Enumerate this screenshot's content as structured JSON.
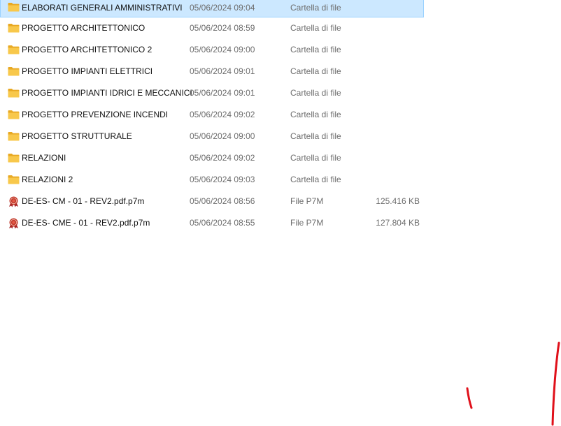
{
  "files": [
    {
      "name": "ELABORATI GENERALI AMMINISTRATIVI",
      "date": "05/06/2024 09:04",
      "type": "Cartella di file",
      "size": "",
      "icon": "folder-icon",
      "selected": true
    },
    {
      "name": "PROGETTO ARCHITETTONICO",
      "date": "05/06/2024 08:59",
      "type": "Cartella di file",
      "size": "",
      "icon": "folder-icon",
      "selected": false
    },
    {
      "name": "PROGETTO ARCHITETTONICO 2",
      "date": "05/06/2024 09:00",
      "type": "Cartella di file",
      "size": "",
      "icon": "folder-icon",
      "selected": false
    },
    {
      "name": "PROGETTO IMPIANTI ELETTRICI",
      "date": "05/06/2024 09:01",
      "type": "Cartella di file",
      "size": "",
      "icon": "folder-icon",
      "selected": false
    },
    {
      "name": "PROGETTO IMPIANTI IDRICI E MECCANICI",
      "date": "05/06/2024 09:01",
      "type": "Cartella di file",
      "size": "",
      "icon": "folder-icon",
      "selected": false
    },
    {
      "name": "PROGETTO PREVENZIONE INCENDI",
      "date": "05/06/2024 09:02",
      "type": "Cartella di file",
      "size": "",
      "icon": "folder-icon",
      "selected": false
    },
    {
      "name": "PROGETTO STRUTTURALE",
      "date": "05/06/2024 09:00",
      "type": "Cartella di file",
      "size": "",
      "icon": "folder-icon",
      "selected": false
    },
    {
      "name": "RELAZIONI",
      "date": "05/06/2024 09:02",
      "type": "Cartella di file",
      "size": "",
      "icon": "folder-icon",
      "selected": false
    },
    {
      "name": "RELAZIONI 2",
      "date": "05/06/2024 09:03",
      "type": "Cartella di file",
      "size": "",
      "icon": "folder-icon",
      "selected": false
    },
    {
      "name": "DE-ES- CM - 01 - REV2.pdf.p7m",
      "date": "05/06/2024 08:56",
      "type": "File P7M",
      "size": "125.416 KB",
      "icon": "signed-file-seal-icon",
      "selected": false
    },
    {
      "name": "DE-ES- CME - 01 - REV2.pdf.p7m",
      "date": "05/06/2024 08:55",
      "type": "File P7M",
      "size": "127.804 KB",
      "icon": "signed-file-seal-icon",
      "selected": false
    }
  ],
  "colors": {
    "selection_bg": "#cce8ff",
    "selection_border": "#99d1ff",
    "folder": "#f8c84b",
    "seal": "#c0392b",
    "secondary_text": "#6d6d6d",
    "annotation": "#e0101a"
  }
}
